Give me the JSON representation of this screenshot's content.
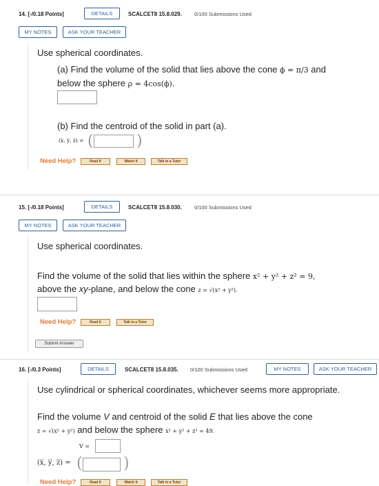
{
  "q14": {
    "number": "14.",
    "points": "[-/0.18 Points]",
    "details_label": "DETAILS",
    "code": "SCALCET8 15.8.029.",
    "submissions": "0/100 Submissions Used",
    "my_notes_label": "MY NOTES",
    "ask_teacher_label": "ASK YOUR TEACHER",
    "intro": "Use spherical coordinates.",
    "part_a_line1_pre": "(a) Find the volume of the solid that lies above the cone ",
    "part_a_line1_math": "ϕ = π/3",
    "part_a_line1_post": " and",
    "part_a_line2_pre": "below the sphere ",
    "part_a_line2_math": "ρ = 4cos(ϕ)",
    "part_a_line2_post": ".",
    "part_b": "(b) Find the centroid of the solid in part (a).",
    "centroid_label": "(x̅, y̅, z̅) =",
    "need_help": "Need Help?",
    "help_buttons": [
      "Read It",
      "Watch It",
      "Talk to a Tutor"
    ]
  },
  "q15": {
    "number": "15.",
    "points": "[-/0.18 Points]",
    "details_label": "DETAILS",
    "code": "SCALCET8 15.8.030.",
    "submissions": "0/100 Submissions Used",
    "my_notes_label": "MY NOTES",
    "ask_teacher_label": "ASK YOUR TEACHER",
    "intro": "Use spherical coordinates.",
    "line1_pre": "Find the volume of the solid that lies within the sphere ",
    "line1_math": "x² + y² + z² = 9,",
    "line2_pre": "above the ",
    "line2_xy": "xy",
    "line2_mid": "-plane, and below the cone ",
    "line2_math": "z = √(x² + y²).",
    "need_help": "Need Help?",
    "help_buttons": [
      "Read It",
      "Talk to a Tutor"
    ],
    "submit_label": "Submit Answer"
  },
  "q16": {
    "number": "16.",
    "points": "[-/0.3 Points]",
    "details_label": "DETAILS",
    "code": "SCALCET8 15.8.035.",
    "submissions": "0/100 Submissions Used",
    "my_notes_label": "MY NOTES",
    "ask_teacher_label": "ASK YOUR TEACHER",
    "intro": "Use cylindrical or spherical coordinates, whichever seems more appropriate.",
    "line1_pre": "Find the volume ",
    "line1_V": "V",
    "line1_mid": " and centroid of the solid ",
    "line1_E": "E",
    "line1_post": " that lies above the cone",
    "line2_math_a": "z = √(x² + y²)",
    "line2_mid": " and below the sphere ",
    "line2_math_b": "x² + y² + z² = 49.",
    "v_label": "V =",
    "centroid_label": "(x̅, y̅, z̅) =",
    "need_help": "Need Help?",
    "help_buttons": [
      "Read It",
      "Watch It",
      "Talk to a Tutor"
    ]
  }
}
